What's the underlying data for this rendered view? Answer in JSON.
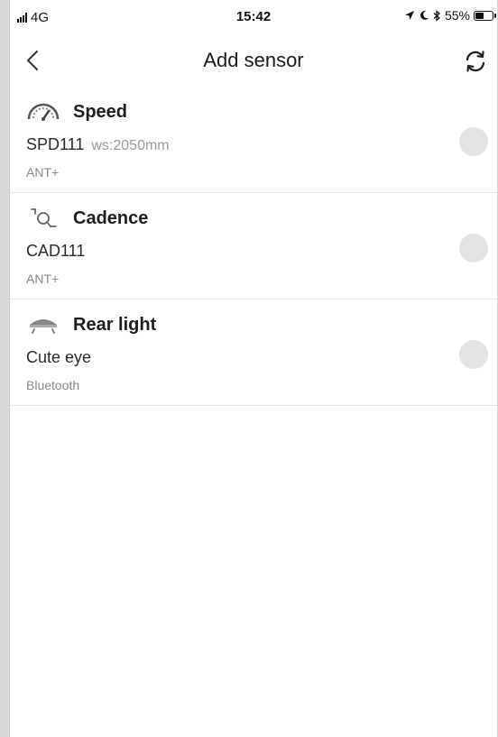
{
  "status_bar": {
    "network": "4G",
    "time": "15:42",
    "battery_text": "55%",
    "battery_level": 0.55,
    "icons": [
      "location-arrow-icon",
      "moon-icon",
      "bluetooth-icon"
    ]
  },
  "header": {
    "title": "Add sensor",
    "back_icon": "chevron-left-icon",
    "refresh_icon": "refresh-icon"
  },
  "sensors": [
    {
      "icon": "speedometer-icon",
      "name": "Speed",
      "model": "SPD111",
      "detail": "ws:2050mm",
      "protocol": "ANT+",
      "selected": false
    },
    {
      "icon": "cadence-sensor-icon",
      "name": "Cadence",
      "model": "CAD111",
      "detail": "",
      "protocol": "ANT+",
      "selected": false
    },
    {
      "icon": "rear-light-icon",
      "name": "Rear light",
      "model": "Cute eye",
      "detail": "",
      "protocol": "Bluetooth",
      "selected": false
    }
  ],
  "colors": {
    "background": "#ffffff",
    "divider": "#e6e6e6",
    "unselected_dot": "#e3e3e3",
    "secondary_text": "#9a9a9a"
  }
}
